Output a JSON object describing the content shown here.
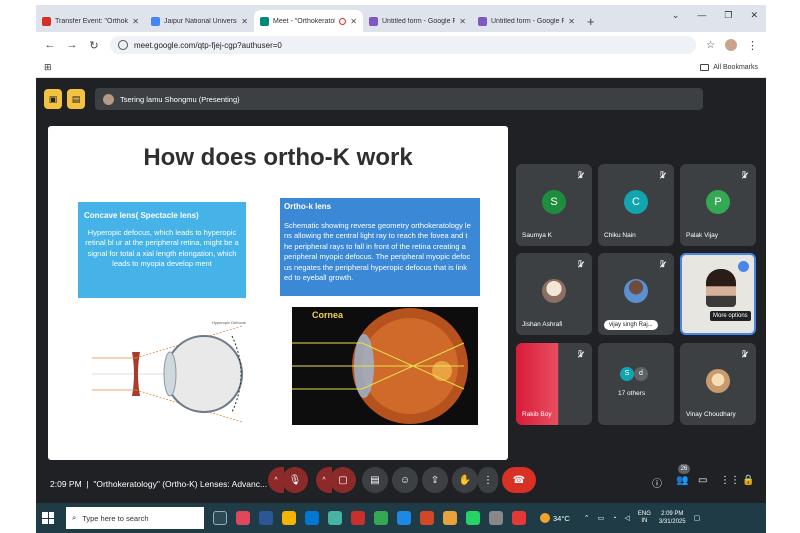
{
  "browser": {
    "tabs": [
      {
        "title": "Transfer Event: \"Orthokeratolog",
        "fav_color": "#d93025",
        "active": false
      },
      {
        "title": "Jaipur National University - Cal",
        "fav_color": "#4285f4",
        "active": false
      },
      {
        "title": "Meet - \"Orthokeratology\"",
        "fav_color": "#00897b",
        "active": true
      },
      {
        "title": "Untitled form - Google Forms",
        "fav_color": "#7e57c2",
        "active": false
      },
      {
        "title": "Untitled form - Google Forms",
        "fav_color": "#7e57c2",
        "active": false
      }
    ],
    "url": "meet.google.com/qtp-fjej-cgp?authuser=0",
    "bookmarks_label": "All Bookmarks"
  },
  "meet": {
    "presenter_label": "Tsering lamu Shongmu (Presenting)",
    "time": "2:09 PM",
    "meeting_title": "\"Orthokeratology\" (Ortho-K) Lenses: Advanc...",
    "people_count": "26"
  },
  "slide": {
    "title": "How does ortho-K work",
    "box1": {
      "heading": "Concave lens( Spectacle lens)",
      "body": "Hyperopic defocus, which leads to hyperopic retinal bl ur at the peripheral retina, might be a signal for total a xial length elongation, which leads to myopia develop ment"
    },
    "box2": {
      "heading": "Ortho-k lens",
      "body": "Schematic showing reverse geometry orthokeratology le ns allowing the central light ray to reach the fovea and t he peripheral rays to fall in front of the retina creating a peripheral myopic defocus. The peripheral myopic defoc us negates the peripheral hyperopic defocus that is link ed to eyeball growth."
    },
    "diagram1_label": "Hyperopic Defocus",
    "diagram2_label": "Cornea"
  },
  "participants": [
    {
      "name": "Saumya K",
      "initial": "S",
      "color": "#1e8e3e"
    },
    {
      "name": "Chiku Nain",
      "initial": "C",
      "color": "#12a4af"
    },
    {
      "name": "Palak Vijay",
      "initial": "P",
      "color": "#34a853"
    },
    {
      "name": "Jishan Ashrafi"
    },
    {
      "name": "vijay singh Raj..."
    },
    {
      "name": "Tsering lamu Shongmu",
      "tooltip": "More options"
    },
    {
      "name": "Rakib Boy"
    },
    {
      "name": "17 others",
      "initials": [
        "S",
        "d"
      ]
    },
    {
      "name": "Vinay Choudhary"
    }
  ],
  "taskbar": {
    "search_placeholder": "Type here to search",
    "weather": "34°C",
    "lang_line1": "ENG",
    "lang_line2": "IN",
    "clock_time": "2:09 PM",
    "clock_date": "3/31/2025"
  }
}
